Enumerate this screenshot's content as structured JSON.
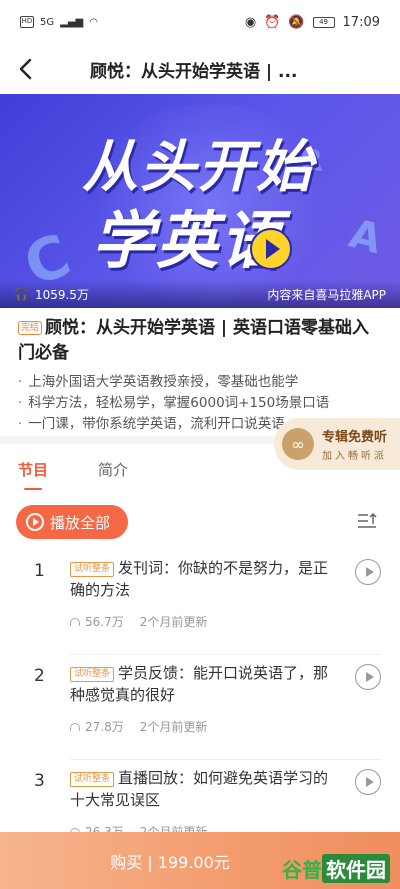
{
  "status_bar": {
    "time": "17:09",
    "network": "HD",
    "signal_label": "5G",
    "battery": "49"
  },
  "nav": {
    "title": "顾悦：从头开始学英语 | ..."
  },
  "banner": {
    "line1": "从头开始",
    "line2": "学英语",
    "plays": "1059.5万",
    "source": "内容来自喜马拉雅APP"
  },
  "album": {
    "badge": "完结",
    "title": "顾悦：从头开始学英语 | 英语口语零基础入门必备",
    "bullets": [
      "上海外国语大学英语教授亲授，零基础也能学",
      "科学方法，轻松易学，掌握6000词+150场景口语",
      "一门课，带你系统学英语，流利开口说英语"
    ]
  },
  "vip_promo": {
    "title": "专辑免费听",
    "subtitle": "加入畅听派"
  },
  "tabs": [
    {
      "label": "节目",
      "active": true
    },
    {
      "label": "简介",
      "active": false
    }
  ],
  "play_all": {
    "label": "播放全部"
  },
  "episodes": [
    {
      "num": "1",
      "tag": "试听整条",
      "title": "发刊词：你缺的不是努力，是正确的方法",
      "plays": "56.7万",
      "updated": "2个月前更新"
    },
    {
      "num": "2",
      "tag": "试听整条",
      "title": "学员反馈：能开口说英语了，那种感觉真的很好",
      "plays": "27.8万",
      "updated": "2个月前更新"
    },
    {
      "num": "3",
      "tag": "试听整条",
      "title": "直播回放：如何避免英语学习的十大常见误区",
      "plays": "26.3万",
      "updated": "2个月前更新"
    }
  ],
  "buy": {
    "label": "购买 | 199.00元"
  },
  "watermark": {
    "part1": "谷普",
    "part2": "软件园"
  },
  "colors": {
    "accent": "#f25c3b",
    "buy_bar": "#f39b6d",
    "banner_bg": "#4b46de"
  }
}
